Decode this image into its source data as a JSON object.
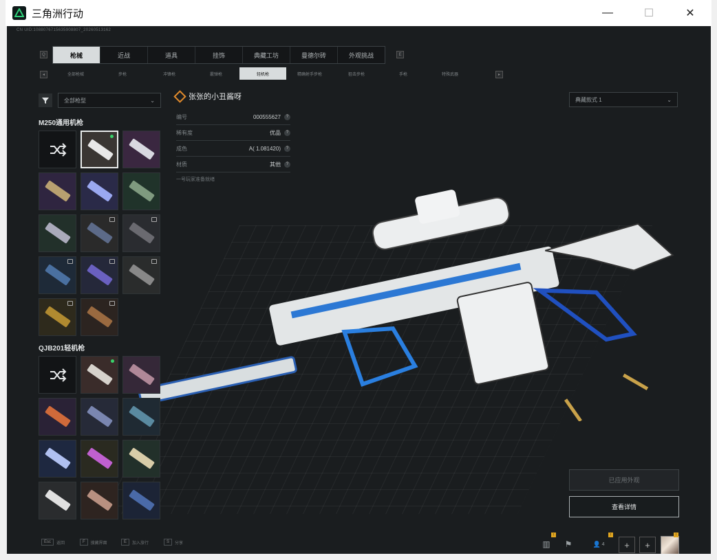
{
  "window": {
    "title": "三角洲行动",
    "minimize": "—",
    "maximize": "☐",
    "close": "✕"
  },
  "uid": "CN UID:1088076715635908807_20260513162",
  "tabs": [
    {
      "label": "枪械",
      "active": true
    },
    {
      "label": "近战"
    },
    {
      "label": "道具"
    },
    {
      "label": "挂饰"
    },
    {
      "label": "典藏工坊"
    },
    {
      "label": "曼德尔砖"
    },
    {
      "label": "外观挑战"
    }
  ],
  "subtabs": [
    {
      "label": "全部枪械"
    },
    {
      "label": "步枪"
    },
    {
      "label": "冲锋枪"
    },
    {
      "label": "霰弹枪"
    },
    {
      "label": "轻机枪",
      "active": true
    },
    {
      "label": "精确射手步枪"
    },
    {
      "label": "狙击步枪"
    },
    {
      "label": "手枪"
    },
    {
      "label": "特殊武器"
    }
  ],
  "filter": {
    "label": "全部枪型"
  },
  "groups": [
    {
      "title": "M250通用机枪"
    },
    {
      "title": "QJB201轻机枪"
    }
  ],
  "weapon_info": {
    "name": "张张的小丑酱呀",
    "rows": [
      {
        "label": "编号",
        "value": "000555627"
      },
      {
        "label": "稀有度",
        "value": "优品"
      },
      {
        "label": "成色",
        "value": "A( 1.081420)"
      },
      {
        "label": "材质",
        "value": "其他"
      }
    ],
    "note": "一号玩家准备就绪"
  },
  "style_select": {
    "label": "典藏款式 1"
  },
  "buttons": {
    "applied": "已应用外观",
    "detail": "查看详情"
  },
  "bottom_hints": [
    {
      "key": "Esc",
      "label": "返回"
    },
    {
      "key": "F",
      "label": "搜藏界面"
    },
    {
      "key": "E",
      "label": "加入旅行"
    },
    {
      "key": "S",
      "label": "分享"
    }
  ],
  "bottom_right": {
    "friends_count": "4",
    "badge": "!"
  },
  "colors": {
    "accent_active_tab": "#d8dcdd",
    "online_dot": "#39d36b",
    "notice_badge": "#e0a520"
  }
}
